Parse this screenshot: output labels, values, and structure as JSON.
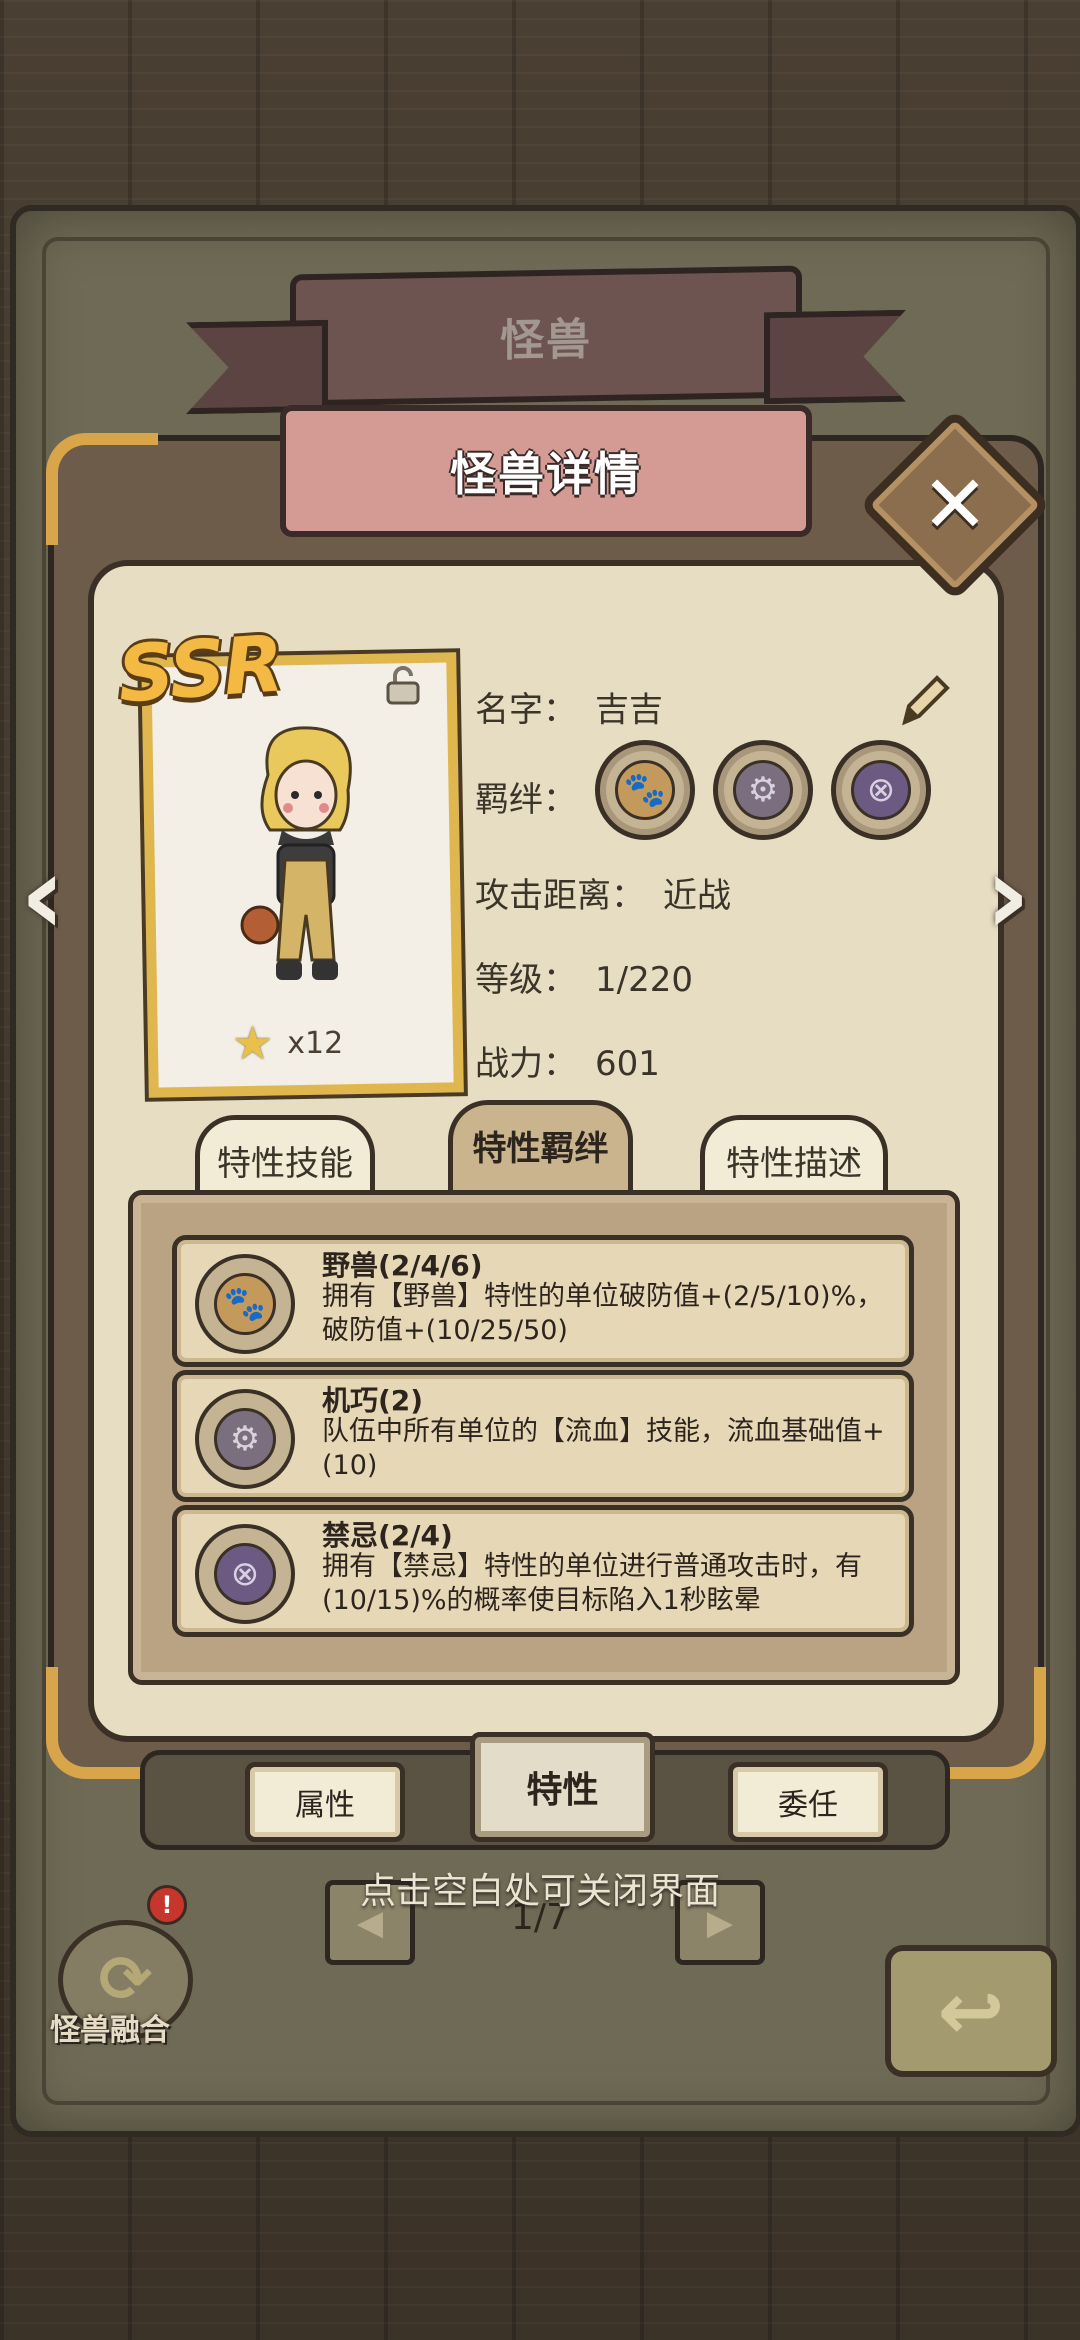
{
  "header": {
    "back_title": "怪兽",
    "title": "怪兽详情"
  },
  "card": {
    "rarity": "SSR",
    "star_count": "x12"
  },
  "info": {
    "name_label": "名字：",
    "name_value": "吉吉",
    "bond_label": "羁绊：",
    "range_label": "攻击距离：",
    "range_value": "近战",
    "level_label": "等级：",
    "level_value": "1/220",
    "power_label": "战力：",
    "power_value": "601"
  },
  "bond_icons": [
    "paw-icon",
    "gear-icon",
    "forbidden-icon"
  ],
  "tabs": [
    {
      "label": "特性技能"
    },
    {
      "label": "特性羁绊"
    },
    {
      "label": "特性描述"
    }
  ],
  "traits": [
    {
      "title": "野兽(2/4/6)",
      "desc": "拥有【野兽】特性的单位破防值+(2/5/10)%，破防值+(10/25/50)",
      "icon": "paw-icon"
    },
    {
      "title": "机巧(2)",
      "desc": "队伍中所有单位的【流血】技能，流血基础值+(10)",
      "icon": "gear-icon"
    },
    {
      "title": "禁忌(2/4)",
      "desc": "拥有【禁忌】特性的单位进行普通攻击时，有(10/15)%的概率使目标陷入1秒眩晕",
      "icon": "forbidden-icon"
    }
  ],
  "bottom_tabs": {
    "left": "属性",
    "center": "特性",
    "right": "委任"
  },
  "hint": "点击空白处可关闭界面",
  "page": "1/7",
  "fusion": {
    "label": "怪兽融合",
    "badge": "!"
  },
  "colors": {
    "gold": "#e0b74f",
    "ribbon_pink": "#d39b94",
    "panel": "#e6ddc3",
    "wood": "#3d3429"
  }
}
